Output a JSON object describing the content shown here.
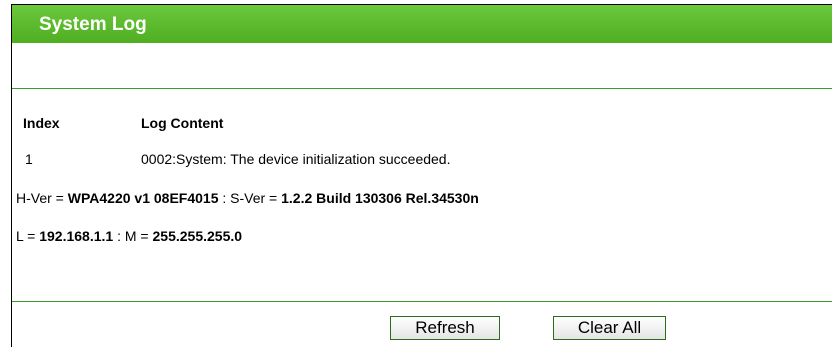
{
  "header": {
    "title": "System Log"
  },
  "table": {
    "headers": {
      "index": "Index",
      "content": "Log Content"
    },
    "rows": [
      {
        "index": "1",
        "content": "0002:System: The device initialization succeeded."
      }
    ]
  },
  "info": {
    "hver_label": "H-Ver = ",
    "hver_value": "WPA4220 v1 08EF4015",
    "sver_label": " : S-Ver = ",
    "sver_value": "1.2.2 Build 130306 Rel.34530n",
    "lan_label": "L = ",
    "lan_value": "192.168.1.1",
    "mask_label": " : M = ",
    "mask_value": "255.255.255.0"
  },
  "buttons": {
    "refresh": "Refresh",
    "clear_all": "Clear All"
  },
  "colors": {
    "header_bg": "#56b528",
    "divider": "#3a9a2e",
    "header_text": "#ffffff"
  }
}
